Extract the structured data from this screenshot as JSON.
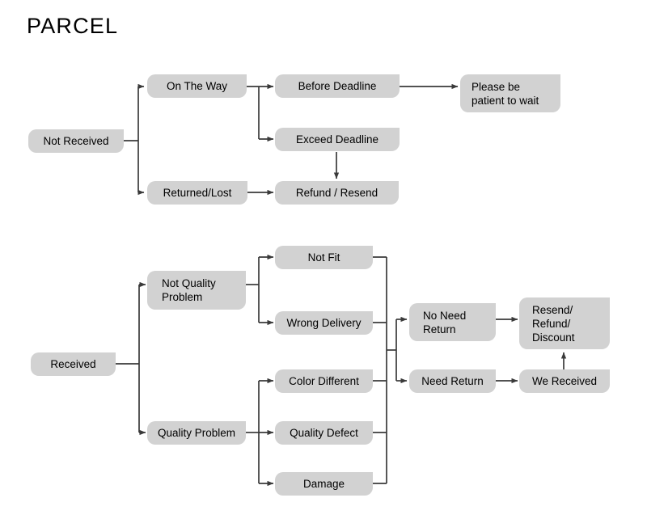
{
  "page": {
    "title": "PARCEL",
    "background_color": "#ffffff",
    "node_fill_color": "#d2d2d2",
    "connector_color": "#3a3a3a",
    "text_color": "#000000"
  },
  "nodes": {
    "not_received": {
      "label": "Not Received"
    },
    "on_the_way": {
      "label": "On The Way"
    },
    "returned_lost": {
      "label": "Returned/Lost"
    },
    "before_deadline": {
      "label": "Before Deadline"
    },
    "exceed_deadline": {
      "label": "Exceed Deadline"
    },
    "refund_resend": {
      "label": "Refund / Resend"
    },
    "please_be_patient": {
      "label": "Please be\npatient to wait"
    },
    "received": {
      "label": "Received"
    },
    "not_quality_problem": {
      "label": "Not Quality\nProblem"
    },
    "quality_problem": {
      "label": "Quality Problem"
    },
    "not_fit": {
      "label": "Not Fit"
    },
    "wrong_delivery": {
      "label": "Wrong Delivery"
    },
    "color_different": {
      "label": "Color Different"
    },
    "quality_defect": {
      "label": "Quality Defect"
    },
    "damage": {
      "label": "Damage"
    },
    "no_need_return": {
      "label": "No Need\nReturn"
    },
    "need_return": {
      "label": "Need Return"
    },
    "resend_refund_discount": {
      "label": "Resend/\nRefund/\nDiscount"
    },
    "we_received": {
      "label": "We Received"
    }
  },
  "flows": {
    "not_received_branches": [
      "On The Way",
      "Returned/Lost"
    ],
    "on_the_way_branches": [
      "Before Deadline",
      "Exceed Deadline"
    ],
    "before_deadline_next": "Please be patient to wait",
    "exceed_deadline_next": "Refund / Resend",
    "returned_lost_next": "Refund / Resend",
    "received_branches": [
      "Not Quality Problem",
      "Quality Problem"
    ],
    "not_quality_problem_branches": [
      "Not Fit",
      "Wrong Delivery"
    ],
    "quality_problem_branches": [
      "Color Different",
      "Quality Defect",
      "Damage"
    ],
    "merge_branches": [
      "No Need Return",
      "Need Return"
    ],
    "no_need_return_next": "Resend/Refund/Discount",
    "need_return_next": "We Received",
    "we_received_next": "Resend/Refund/Discount"
  }
}
